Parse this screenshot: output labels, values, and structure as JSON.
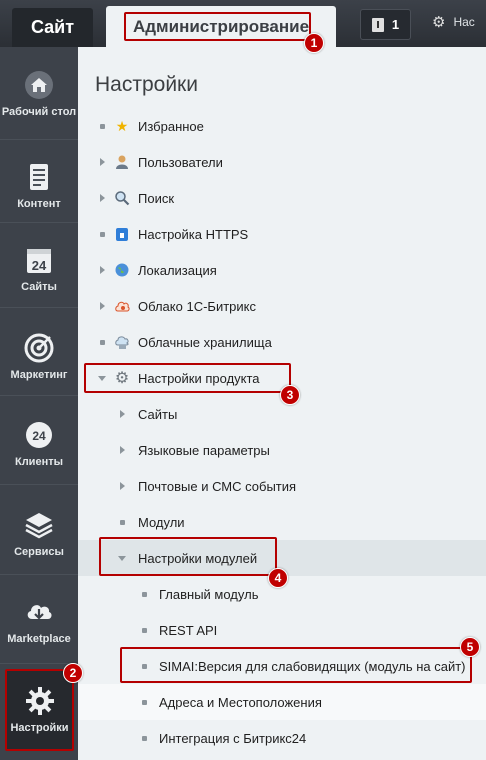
{
  "topbar": {
    "site_tab": "Сайт",
    "admin_tab": "Администрирование",
    "notifications_count": "1",
    "settings_label": "Нас"
  },
  "sidebar": {
    "items": [
      {
        "label": "Рабочий стол",
        "icon": "home-icon"
      },
      {
        "label": "Контент",
        "icon": "document-icon"
      },
      {
        "label": "Сайты",
        "icon": "calendar-24-icon"
      },
      {
        "label": "Маркетинг",
        "icon": "target-icon"
      },
      {
        "label": "Клиенты",
        "icon": "clients-24-icon"
      },
      {
        "label": "Сервисы",
        "icon": "layers-icon"
      },
      {
        "label": "Marketplace",
        "icon": "cloud-download-icon"
      },
      {
        "label": "Настройки",
        "icon": "gear-icon"
      }
    ]
  },
  "main": {
    "title": "Настройки",
    "items": [
      {
        "label": "Избранное",
        "icon": "star-icon",
        "marker": "dot"
      },
      {
        "label": "Пользователи",
        "icon": "user-icon",
        "marker": "arrow-right"
      },
      {
        "label": "Поиск",
        "icon": "search-icon",
        "marker": "arrow-right"
      },
      {
        "label": "Настройка HTTPS",
        "icon": "lock-icon",
        "marker": "dot"
      },
      {
        "label": "Локализация",
        "icon": "globe-icon",
        "marker": "arrow-right"
      },
      {
        "label": "Облако 1С-Битрикс",
        "icon": "cloud-bitrix-icon",
        "marker": "arrow-right"
      },
      {
        "label": "Облачные хранилища",
        "icon": "cloud-storage-icon",
        "marker": "dot"
      },
      {
        "label": "Настройки продукта",
        "icon": "gear-icon",
        "marker": "arrow-down"
      },
      {
        "label": "Сайты",
        "marker": "arrow-right"
      },
      {
        "label": "Языковые параметры",
        "marker": "arrow-right"
      },
      {
        "label": "Почтовые и СМС события",
        "marker": "arrow-right"
      },
      {
        "label": "Модули",
        "marker": "dot"
      },
      {
        "label": "Настройки модулей",
        "marker": "arrow-down"
      },
      {
        "label": "Главный модуль",
        "marker": "dot"
      },
      {
        "label": "REST API",
        "marker": "dot"
      },
      {
        "label": "SIMAI:Версия для слабовидящих (модуль на сайт)",
        "marker": "dot"
      },
      {
        "label": "Адреса и Местоположения",
        "marker": "dot"
      },
      {
        "label": "Интеграция с Битрикс24",
        "marker": "dot"
      }
    ]
  },
  "callouts": [
    "1",
    "2",
    "3",
    "4",
    "5"
  ],
  "colors": {
    "accent_red": "#c00000",
    "sidebar_bg": "#3d424a",
    "topbar_bg": "#2b2f35",
    "content_bg": "#eef2f4"
  }
}
